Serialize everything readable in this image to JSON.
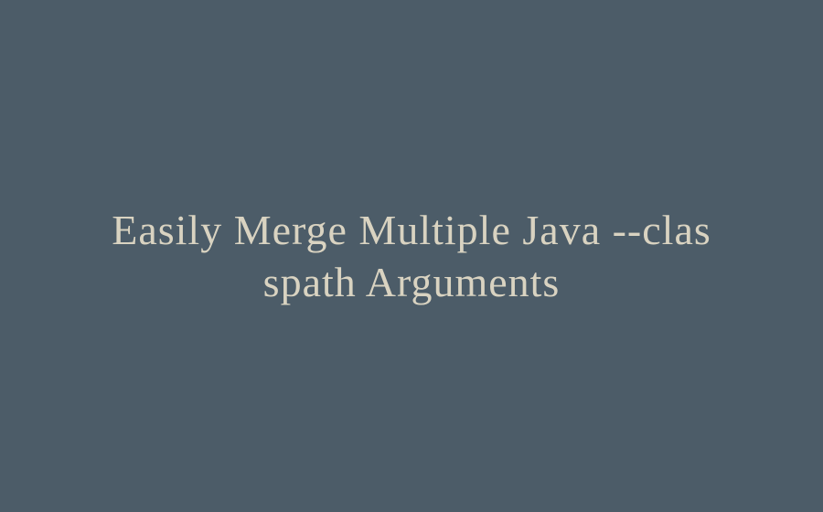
{
  "title": {
    "text": "Easily Merge Multiple Java --classpath Arguments"
  },
  "colors": {
    "background": "#4c5c68",
    "text": "#d9d3c1"
  }
}
